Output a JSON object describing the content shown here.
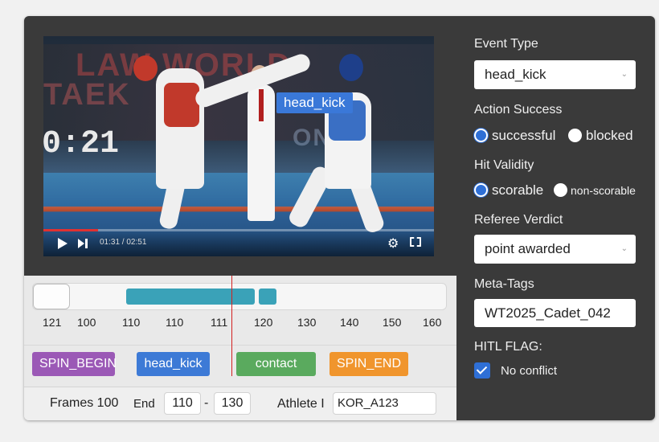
{
  "video": {
    "banner_line1": "LAW WORLD",
    "banner_line2": "TAEK",
    "banner_line3": "ONDO",
    "scoreboard_clock": "0:21",
    "overlay_tag": "head_kick",
    "time_readout": "01:31 / 02:51",
    "progress_fraction": 0.14
  },
  "timeline": {
    "tick_labels": [
      "121",
      "100",
      "110",
      "110",
      "111",
      "120",
      "130",
      "140",
      "150",
      "160"
    ],
    "events": [
      "SPIN_BEGIN",
      "head_kick",
      "contact",
      "SPIN_END"
    ],
    "frames_label": "Frames 100",
    "end_label": "End",
    "start_value": "110",
    "dash": "-",
    "end_value": "130",
    "athlete_label": "Athlete I",
    "athlete_value": "KOR_A123"
  },
  "panel": {
    "event_type_label": "Event Type",
    "event_type_value": "head_kick",
    "action_success_label": "Action Success",
    "success_options": [
      "successful",
      "blocked"
    ],
    "success_selected": "successful",
    "hit_validity_label": "Hit Validity",
    "validity_options": [
      "scorable",
      "non-scorable"
    ],
    "validity_selected": "scorable",
    "referee_label": "Referee Verdict",
    "referee_value": "point awarded",
    "meta_label": "Meta-Tags",
    "meta_value": "WT2025_Cadet_042",
    "hitl_label": "HITL FLAG:",
    "hitl_option": "No conflict",
    "hitl_checked": true
  },
  "colors": {
    "accent_blue": "#2e6fd6",
    "segment_teal": "#3aa2b8",
    "spin_begin": "#9b59b6",
    "head_kick": "#3d7ad6",
    "contact": "#5aaa5e",
    "spin_end": "#f0952d",
    "playhead": "#d42020"
  }
}
